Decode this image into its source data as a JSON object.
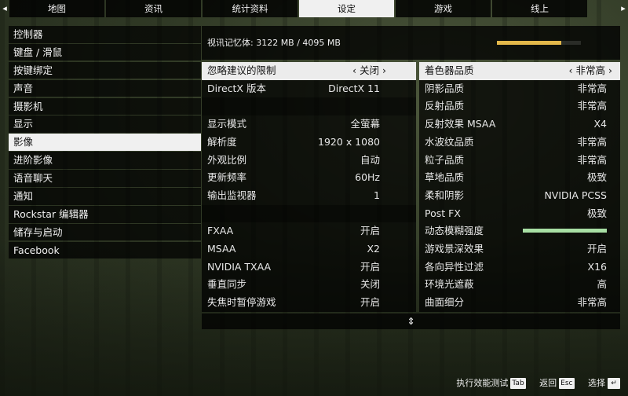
{
  "tabs": {
    "left_arrow": "◂",
    "right_arrow": "▸",
    "items": [
      {
        "label": "地图"
      },
      {
        "label": "资讯"
      },
      {
        "label": "统计资料"
      },
      {
        "label": "设定",
        "active": true
      },
      {
        "label": "游戏"
      },
      {
        "label": "线上"
      }
    ]
  },
  "menu": {
    "items": [
      {
        "label": "控制器"
      },
      {
        "label": "键盘 / 滑鼠"
      },
      {
        "label": "按键绑定"
      },
      {
        "label": "声音"
      },
      {
        "label": "摄影机"
      },
      {
        "label": "显示"
      },
      {
        "label": "影像",
        "active": true
      },
      {
        "label": "进阶影像"
      },
      {
        "label": "语音聊天"
      },
      {
        "label": "通知"
      },
      {
        "label": "Rockstar 编辑器"
      },
      {
        "label": "储存与启动"
      },
      {
        "label": "Facebook"
      }
    ]
  },
  "vram": {
    "label": "视讯记忆体: 3122 MB / 4095 MB",
    "fill_fraction": 0.762
  },
  "left_settings": [
    {
      "label": "忽略建议的限制",
      "value": "‹ 关闭 ›",
      "header": true
    },
    {
      "label": "DirectX 版本",
      "value": "DirectX 11"
    },
    {
      "spacer": true
    },
    {
      "label": "显示模式",
      "value": "全萤幕"
    },
    {
      "label": "解析度",
      "value": "1920 x 1080"
    },
    {
      "label": "外观比例",
      "value": "自动"
    },
    {
      "label": "更新频率",
      "value": "60Hz"
    },
    {
      "label": "输出监视器",
      "value": "1"
    },
    {
      "spacer": true
    },
    {
      "label": "FXAA",
      "value": "开启"
    },
    {
      "label": "MSAA",
      "value": "X2"
    },
    {
      "label": "NVIDIA TXAA",
      "value": "开启"
    },
    {
      "label": "垂直同步",
      "value": "关闭"
    },
    {
      "label": "失焦时暂停游戏",
      "value": "开启"
    }
  ],
  "right_settings": [
    {
      "label": "着色器品质",
      "value": "‹ 非常高 ›",
      "header": true
    },
    {
      "label": "阴影品质",
      "value": "非常高"
    },
    {
      "label": "反射品质",
      "value": "非常高"
    },
    {
      "label": "反射效果 MSAA",
      "value": "X4"
    },
    {
      "label": "水波纹品质",
      "value": "非常高"
    },
    {
      "label": "粒子品质",
      "value": "非常高"
    },
    {
      "label": "草地品质",
      "value": "极致"
    },
    {
      "label": "柔和阴影",
      "value": "NVIDIA PCSS"
    },
    {
      "label": "Post FX",
      "value": "极致"
    },
    {
      "label": "动态模糊强度",
      "slider": 1.0
    },
    {
      "label": "游戏景深效果",
      "value": "开启"
    },
    {
      "label": "各向异性过滤",
      "value": "X16"
    },
    {
      "label": "环境光遮蔽",
      "value": "高"
    },
    {
      "label": "曲面细分",
      "value": "非常高"
    }
  ],
  "scroll_icon": "⇕",
  "hints": [
    {
      "label": "执行效能测试",
      "key": "Tab"
    },
    {
      "label": "返回",
      "key": "Esc"
    },
    {
      "label": "选择",
      "key": "↵"
    }
  ],
  "colors": {
    "vram_bar": "#e3b84a",
    "motion_slider": "#a8dfa4",
    "active_bg": "#f0f0f0"
  }
}
